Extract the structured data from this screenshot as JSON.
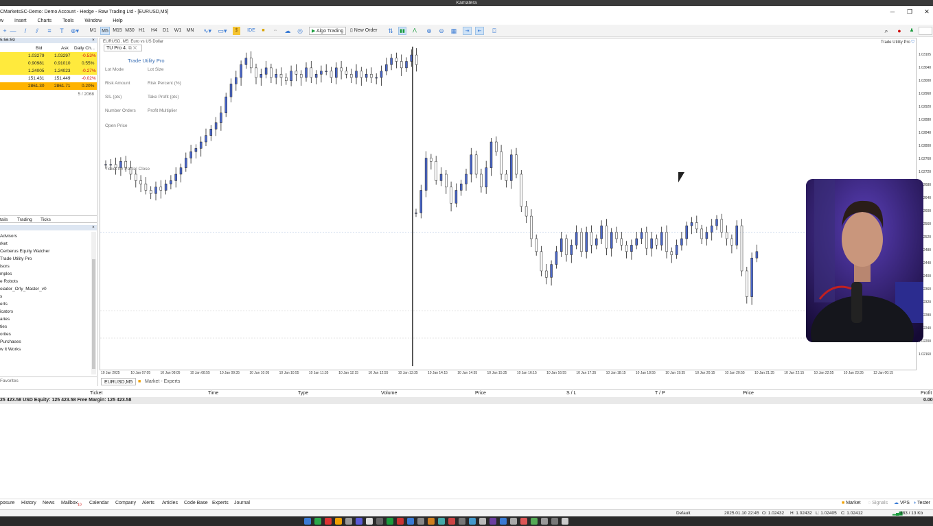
{
  "os_title": "Kamatera",
  "window_title": "CMarketsSC-Demo: Demo Account - Hedge - Raw Trading Ltd - [EURUSD,M5]",
  "window_controls": [
    "─",
    "❐",
    "✕"
  ],
  "menu": [
    "w",
    "Insert",
    "Charts",
    "Tools",
    "Window",
    "Help"
  ],
  "toolbar": {
    "timeframes": [
      "M1",
      "M5",
      "M15",
      "M30",
      "H1",
      "H4",
      "D1",
      "W1",
      "MN"
    ],
    "active_timeframe": "M5",
    "ide": "IDE",
    "algo_trading": "Algo Trading",
    "new_order": "New Order"
  },
  "market_watch": {
    "time": "5:56:59",
    "headers": {
      "bid": "Bid",
      "ask": "Ask",
      "daily": "Daily Ch..."
    },
    "rows": [
      {
        "bid": "1.03279",
        "ask": "1.03297",
        "change": "-0.53%",
        "style": "yel",
        "neg": true
      },
      {
        "bid": "0.90981",
        "ask": "0.91010",
        "change": "0.55%",
        "style": "yel",
        "neg": false
      },
      {
        "bid": "1.24005",
        "ask": "1.24023",
        "change": "-0.27%",
        "style": "yel",
        "neg": true
      },
      {
        "bid": "151.431",
        "ask": "151.449",
        "change": "-0.02%",
        "style": "none",
        "neg": true
      },
      {
        "bid": "2861.30",
        "ask": "2861.71",
        "change": "0.20%",
        "style": "ora",
        "neg": false
      }
    ],
    "count": "5 / 2068",
    "tabs": [
      "tails",
      "Trading",
      "Ticks"
    ]
  },
  "navigator": {
    "items": [
      "Advisors",
      "rket",
      "Cerberus Equity Watcher",
      "Trade Utility Pro",
      "isors",
      "mples",
      "e Robots",
      "oiador_Orly_Master_v0",
      "s",
      "erts",
      "icators",
      "aries",
      "ties",
      "orites",
      "Purchases",
      "w It Works"
    ],
    "footer": "Favorites"
  },
  "chart": {
    "symbol_header": "EURUSD, M5:  Euro vs US Dollar",
    "indicator_tag": "TU Pro 4.",
    "top_right_label": "Trade Utility Pro",
    "panel": {
      "title": "Trade Utility Pro",
      "labels": {
        "lot_mode": "Lot Mode",
        "lot_size": "Lot Size",
        "risk_amount": "Risk Amount",
        "risk_percent": "Risk Percent (%)",
        "sl": "S/L (pts)",
        "tp": "Take Profit (pts)",
        "number_orders": "Number Orders",
        "profit_multiplier": "Profit Multiplier",
        "open_price": "Open Price",
        "ticket_partial": "Ticket for Partial Close"
      }
    }
  },
  "chart_data": {
    "type": "candlestick",
    "y_ticks": [
      "1.03105",
      "1.03040",
      "1.03000",
      "1.02960",
      "1.02920",
      "1.02880",
      "1.02840",
      "1.02800",
      "1.02760",
      "1.02720",
      "1.02680",
      "1.02640",
      "1.02600",
      "1.02560",
      "1.02520",
      "1.02480",
      "1.02440",
      "1.02400",
      "1.02360",
      "1.02320",
      "1.02280",
      "1.02240",
      "1.02200",
      "1.02160"
    ],
    "x_ticks": [
      "10 Jan 2025",
      "10 Jan 07:05",
      "10 Jan 08:05",
      "10 Jan 08:55",
      "10 Jan 09:35",
      "10 Jan 10:05",
      "10 Jan 10:55",
      "10 Jan 11:35",
      "10 Jan 12:15",
      "10 Jan 12:55",
      "10 Jan 13:35",
      "10 Jan 14:15",
      "10 Jan 14:55",
      "10 Jan 15:35",
      "10 Jan 16:15",
      "10 Jan 16:55",
      "10 Jan 17:35",
      "10 Jan 18:15",
      "10 Jan 18:55",
      "10 Jan 19:35",
      "10 Jan 20:15",
      "10 Jan 20:55",
      "10 Jan 21:35",
      "10 Jan 22:15",
      "10 Jan 22:55",
      "10 Jan 23:35",
      "13 Jan 00:15"
    ],
    "series": [
      {
        "points": [
          0.63,
          0.63,
          0.62,
          0.64,
          0.62,
          0.6,
          0.58,
          0.57,
          0.55,
          0.54,
          0.56,
          0.55,
          0.57,
          0.58,
          0.6,
          0.62,
          0.65,
          0.67,
          0.68,
          0.7,
          0.72,
          0.74,
          0.76,
          0.79,
          0.84,
          0.88,
          0.9,
          0.94,
          0.96,
          0.93,
          0.9,
          0.91,
          0.93,
          0.9,
          0.91,
          0.9,
          0.89,
          0.92,
          0.91,
          0.9,
          0.93,
          0.9,
          0.91,
          0.92,
          0.92,
          0.9,
          0.93,
          0.92,
          0.91,
          0.9,
          0.92,
          0.9,
          0.91,
          0.9,
          0.9,
          0.92,
          0.94,
          0.96,
          0.95,
          0.93,
          0.95,
          0.97,
          0.94
        ]
      },
      {
        "points": [
          0.48,
          0.55,
          0.65,
          0.64,
          0.58,
          0.6,
          0.56,
          0.51,
          0.55,
          0.57,
          0.6,
          0.66,
          0.6,
          0.56,
          0.62,
          0.7,
          0.67,
          0.6,
          0.58,
          0.66,
          0.6,
          0.5,
          0.47,
          0.4,
          0.36,
          0.3,
          0.28,
          0.32,
          0.36,
          0.4,
          0.35,
          0.38,
          0.42,
          0.36,
          0.42,
          0.38,
          0.4,
          0.44,
          0.37,
          0.42,
          0.4,
          0.38,
          0.36,
          0.38,
          0.4,
          0.42,
          0.37,
          0.4,
          0.38,
          0.42,
          0.36,
          0.35,
          0.38,
          0.4,
          0.44,
          0.45,
          0.43,
          0.4,
          0.42,
          0.44,
          0.46,
          0.42,
          0.4,
          0.38,
          0.44,
          0.3,
          0.22,
          0.34,
          0.36
        ]
      }
    ]
  },
  "chart_tabs": [
    "EURUSD,M5",
    "Market - Experts"
  ],
  "trade_headers": [
    "Ticket",
    "Time",
    "Type",
    "Volume",
    "Price",
    "S / L",
    "T / P",
    "Price",
    "Profit"
  ],
  "balance_line": "25 423.58 USD  Equity: 125 423.58  Free Margin: 125 423.58",
  "balance_total": "0.00",
  "bottom_tabs": [
    "posure",
    "History",
    "News",
    "Mailbox",
    "Calendar",
    "Company",
    "Alerts",
    "Articles",
    "Code Base",
    "Experts",
    "Journal"
  ],
  "mailbox_badge": "10",
  "bottom_right": [
    "Market",
    "Signals",
    "VPS",
    "Tester"
  ],
  "status": {
    "profile": "Default",
    "datetime": "2025.01.10 22:45",
    "open": "O: 1.02432",
    "high": "H: 1.02432",
    "low": "L: 1.02405",
    "close": "C: 1.02412",
    "traffic": "383 / 13 Kb"
  }
}
